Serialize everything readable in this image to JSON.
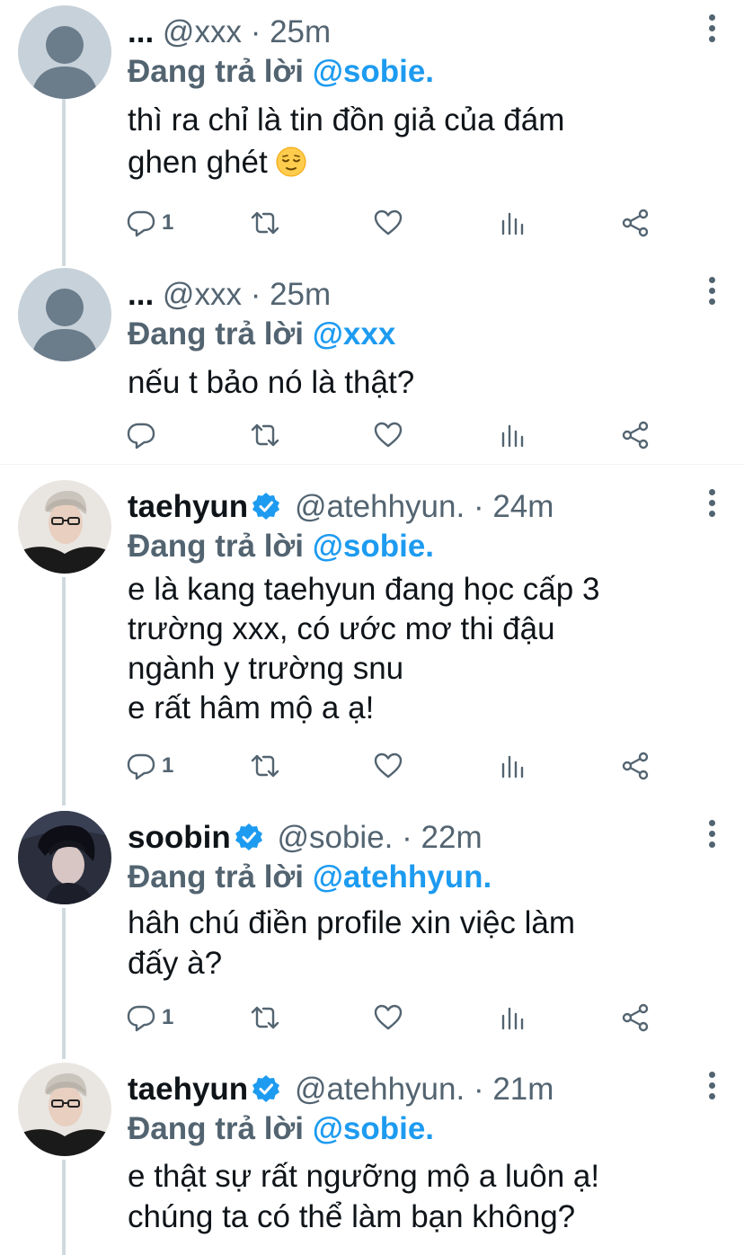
{
  "tweets": [
    {
      "name": "...",
      "handle": "@xxx",
      "time": "25m",
      "replying_label": "Đang trả lời",
      "replying_to": "@sobie.",
      "lines": [
        "thì ra chỉ là tin đồn giả của đám",
        "ghen ghét"
      ],
      "emoji": "relieved-face",
      "reply_count": "1",
      "avatar": "default-avatar"
    },
    {
      "name": "...",
      "handle": "@xxx",
      "time": "25m",
      "replying_label": "Đang trả lời",
      "replying_to": "@xxx",
      "lines": [
        "nếu t bảo nó là thật?"
      ],
      "reply_count": "",
      "avatar": "default-avatar"
    },
    {
      "name": "taehyun",
      "handle": "@atehhyun.",
      "time": "24m",
      "verified": true,
      "replying_label": "Đang trả lời",
      "replying_to": "@sobie.",
      "lines": [
        "e là kang taehyun đang học cấp 3",
        "trường xxx, có ước mơ thi đậu",
        "ngành y trường snu",
        "e rất hâm mộ a ạ!"
      ],
      "reply_count": "1",
      "avatar": "user-photo"
    },
    {
      "name": "soobin",
      "handle": "@sobie.",
      "time": "22m",
      "verified": true,
      "replying_label": "Đang trả lời",
      "replying_to": "@atehhyun.",
      "lines": [
        "hâh chú điền profile xin việc làm",
        "đấy à?"
      ],
      "reply_count": "1",
      "avatar": "user-photo"
    },
    {
      "name": "taehyun",
      "handle": "@atehhyun.",
      "time": "21m",
      "verified": true,
      "replying_label": "Đang trả lời",
      "replying_to": "@sobie.",
      "lines": [
        "e thật sự rất ngưỡng mộ a luôn ạ!",
        "chúng ta có thể làm bạn không?"
      ],
      "avatar": "user-photo"
    }
  ],
  "separator": "·",
  "icons": [
    "reply-icon",
    "retweet-icon",
    "like-icon",
    "stats-icon",
    "share-icon",
    "more-icon",
    "verified-badge-icon"
  ],
  "colors": {
    "accent": "#1d9bf0",
    "muted": "#536471",
    "text": "#0f1419",
    "thread_line": "#cfd9de"
  }
}
